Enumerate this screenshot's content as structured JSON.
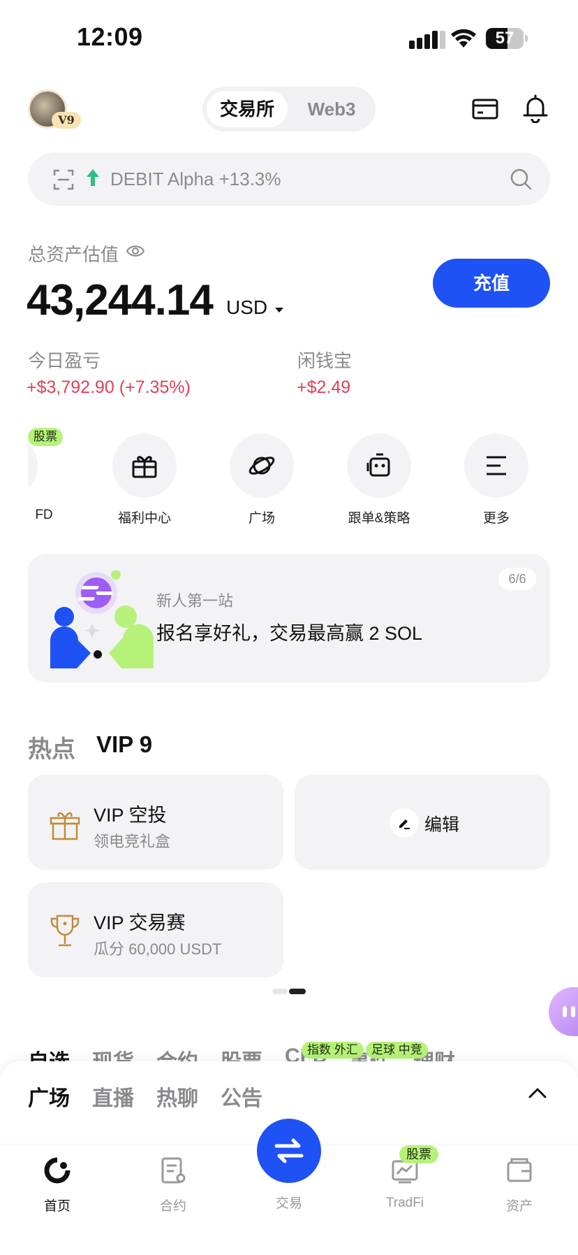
{
  "status_bar": {
    "time": "12:09",
    "battery": "57",
    "battery_level": 0.57
  },
  "top_nav": {
    "avatar_badge": "V9",
    "toggle": {
      "active": "交易所",
      "inactive": "Web3"
    },
    "icons": [
      "card-icon",
      "bell-icon"
    ]
  },
  "search": {
    "placeholder": "DEBIT Alpha +13.3%",
    "trend_icon": "arrow-up-icon",
    "trend_color": "#2ebd85"
  },
  "assets": {
    "label": "总资产估值",
    "value": "43,244.14",
    "currency": "USD",
    "deposit_label": "充值",
    "pnl_label": "今日盈亏",
    "pnl_value": "+$3,792.90 (+7.35%)",
    "idle_label": "闲钱宝",
    "idle_value": "+$2.49"
  },
  "quick_actions": {
    "partial_label": "FD",
    "partial_tag": "股票",
    "items": [
      {
        "label": "福利中心",
        "icon": "gift-icon"
      },
      {
        "label": "广场",
        "icon": "planet-icon"
      },
      {
        "label": "跟单&策略",
        "icon": "bot-icon"
      },
      {
        "label": "更多",
        "icon": "menu-icon"
      }
    ]
  },
  "promo": {
    "subtitle": "新人第一站",
    "title": "报名享好礼，交易最高赢 2 SOL",
    "counter": "6/6"
  },
  "hot": {
    "title": "热点",
    "vip_title": "VIP 9",
    "tiles": [
      {
        "title": "VIP 空投",
        "subtitle": "领电竞礼盒",
        "icon": "gift-box-icon"
      },
      {
        "title": "VIP 交易赛",
        "subtitle": "瓜分 60,000 USDT",
        "icon": "trophy-icon"
      }
    ],
    "edit_label": "编辑",
    "page_indicator": {
      "current": 2,
      "total": 2
    }
  },
  "market_tabs": {
    "items": [
      "自选",
      "现货",
      "合约",
      "股票",
      "CFD",
      "事件",
      "理财"
    ],
    "tags": [
      "指数\n外汇",
      "足球\n中竞"
    ]
  },
  "sheet": {
    "tabs": [
      "广场",
      "直播",
      "热聊",
      "公告"
    ]
  },
  "bottom_nav": {
    "items": [
      {
        "label": "首页",
        "icon": "home-icon"
      },
      {
        "label": "合约",
        "icon": "contract-icon"
      },
      {
        "label": "交易",
        "icon": "swap-icon"
      },
      {
        "label": "TradFi",
        "icon": "tradfi-icon"
      },
      {
        "label": "资产",
        "icon": "wallet-icon"
      }
    ],
    "tradfi_tag": "股票"
  },
  "colors": {
    "accent": "#1f52f4",
    "loss_gain": "#e0405a",
    "tag_green": "#b6f27a"
  }
}
